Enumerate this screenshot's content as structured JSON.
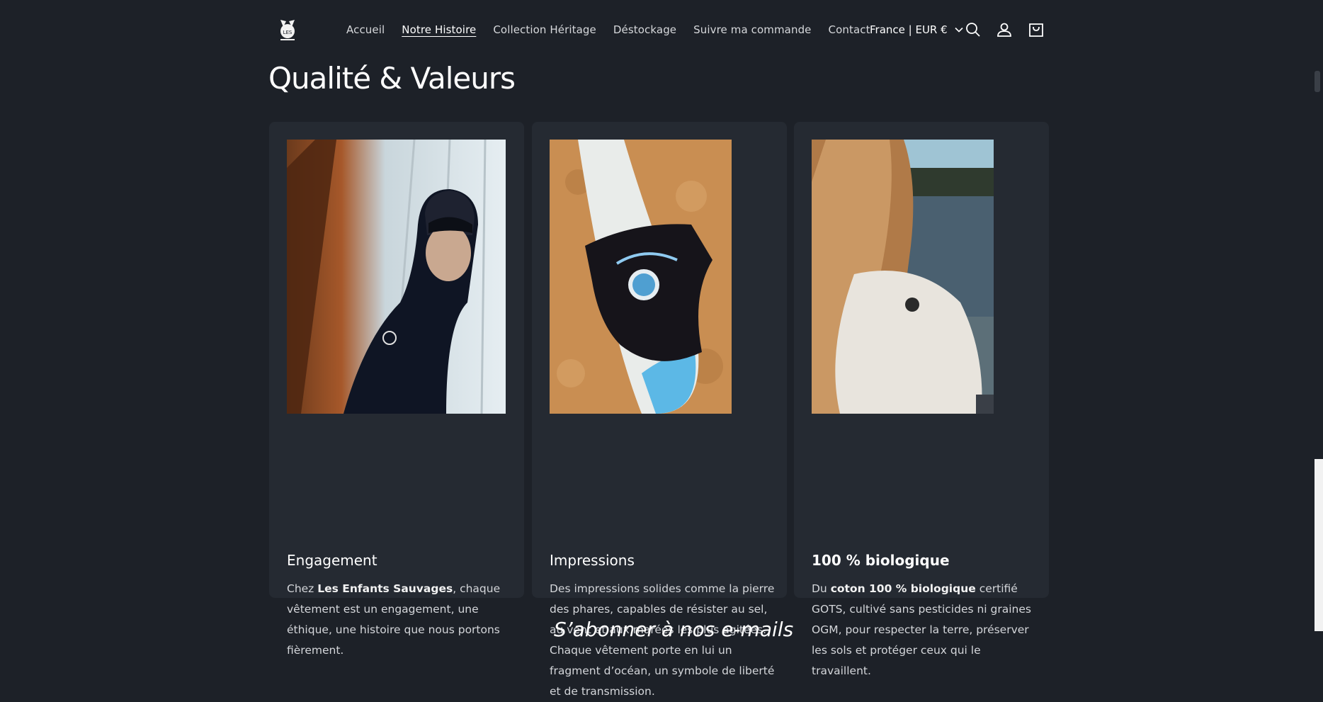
{
  "header": {
    "logo_text": "LES",
    "nav": [
      {
        "label": "Accueil",
        "active": false
      },
      {
        "label": "Notre Histoire",
        "active": true
      },
      {
        "label": "Collection Héritage",
        "active": false
      },
      {
        "label": "Déstockage",
        "active": false
      },
      {
        "label": "Suivre ma commande",
        "active": false
      },
      {
        "label": "Contact",
        "active": false
      }
    ],
    "locale": "France | EUR €",
    "icons": [
      "search-icon",
      "account-icon",
      "cart-icon"
    ]
  },
  "page": {
    "title": "Qualité & Valeurs"
  },
  "cards": [
    {
      "title": "Engagement",
      "text_pre": "Chez ",
      "text_bold": "Les Enfants Sauvages",
      "text_post": ", chaque vêtement est un engagement, une éthique, une histoire que nous portons fièrement."
    },
    {
      "title": "Impressions",
      "text_pre": "Des impressions solides comme la pierre des phares, capables de résister au sel, au vent et aux marées les plus agitées. Chaque vêtement porte en lui un fragment d’océan, un symbole de liberté et de transmission.",
      "text_bold": "",
      "text_post": ""
    },
    {
      "title": "100 % biologique",
      "text_pre": "Du ",
      "text_bold": "coton 100 % biologique",
      "text_post": " certifié GOTS, cultivé sans pesticides ni graines OGM, pour respecter la terre, préserver les sols et protéger ceux qui le travaillent."
    }
  ],
  "footer": {
    "newsletter_heading": "S’abonner à nos e-mails"
  },
  "colors": {
    "background": "#1d2128",
    "card": "#252a32",
    "text": "#ffffff"
  }
}
